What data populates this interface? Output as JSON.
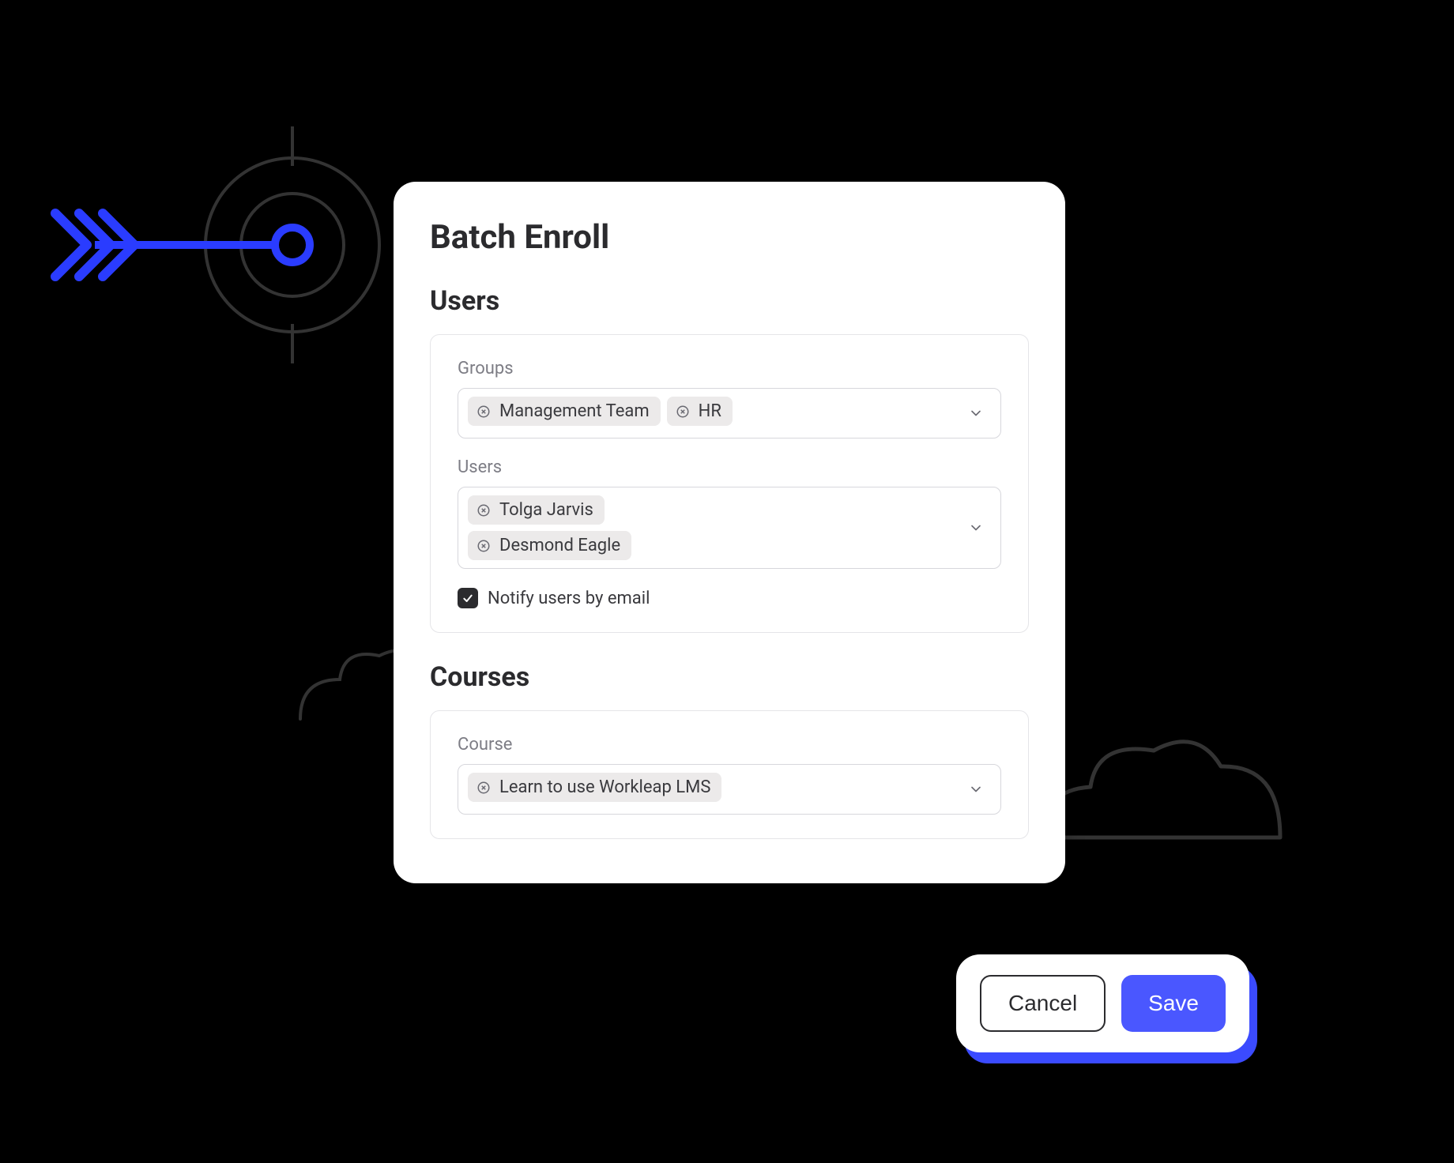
{
  "modal": {
    "title": "Batch Enroll",
    "users_section": {
      "heading": "Users",
      "groups_label": "Groups",
      "groups": [
        "Management Team",
        "HR"
      ],
      "users_label": "Users",
      "users": [
        "Tolga Jarvis",
        "Desmond Eagle"
      ],
      "notify_checkbox": {
        "checked": true,
        "label": "Notify users by email"
      }
    },
    "courses_section": {
      "heading": "Courses",
      "course_label": "Course",
      "courses": [
        "Learn to use Workleap LMS"
      ]
    }
  },
  "actions": {
    "cancel": "Cancel",
    "save": "Save"
  },
  "colors": {
    "accent_blue": "#4a57ff",
    "arrow_blue": "#2a3cff"
  }
}
